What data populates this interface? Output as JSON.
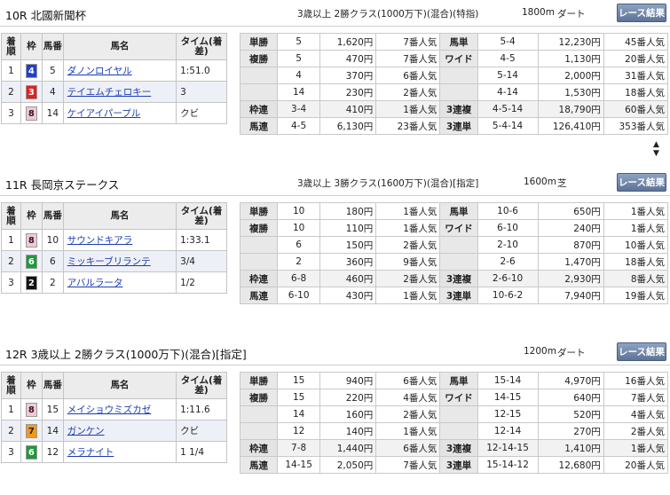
{
  "races": [
    {
      "name": "10R 北國新聞杯",
      "conditions": "3歳以上 2勝クラス(1000万下)(混合)(特指)",
      "distance": "1800m",
      "surface": "ダート",
      "button": "レース結果",
      "headers": {
        "rank": "着順",
        "frame": "枠",
        "number": "馬番",
        "horse": "馬名",
        "time": "タイム(着差)"
      },
      "results": [
        {
          "rank": "1",
          "frame": "4",
          "frame_bg": "#1f3fd1",
          "frame_fg": "#ffffff",
          "number": "5",
          "horse": "ダノンロイヤル",
          "time": "1:51.0"
        },
        {
          "rank": "2",
          "frame": "3",
          "frame_bg": "#e0211f",
          "frame_fg": "#ffffff",
          "number": "4",
          "horse": "テイエムチェロキー",
          "time": "3"
        },
        {
          "rank": "3",
          "frame": "8",
          "frame_bg": "#f7c6d4",
          "frame_fg": "#222222",
          "number": "14",
          "horse": "ケイアイパープル",
          "time": "クビ"
        }
      ],
      "payouts": [
        {
          "l1": "単勝",
          "c1": "5",
          "y1": "1,620円",
          "p1": "7番人気",
          "l2": "馬単",
          "c2": "5-4",
          "y2": "12,230円",
          "p2": "45番人気"
        },
        {
          "l1": "複勝",
          "c1": "5",
          "y1": "470円",
          "p1": "7番人気",
          "l2": "ワイド",
          "c2": "4-5",
          "y2": "1,130円",
          "p2": "20番人気"
        },
        {
          "l1": "",
          "c1": "4",
          "y1": "370円",
          "p1": "6番人気",
          "l2": "",
          "c2": "5-14",
          "y2": "2,000円",
          "p2": "31番人気"
        },
        {
          "l1": "",
          "c1": "14",
          "y1": "230円",
          "p1": "2番人気",
          "l2": "",
          "c2": "4-14",
          "y2": "1,530円",
          "p2": "18番人気"
        },
        {
          "l1": "枠連",
          "c1": "3-4",
          "y1": "410円",
          "p1": "1番人気",
          "l2": "3連複",
          "c2": "4-5-14",
          "y2": "18,790円",
          "p2": "60番人気"
        },
        {
          "l1": "馬連",
          "c1": "4-5",
          "y1": "6,130円",
          "p1": "23番人気",
          "l2": "3連単",
          "c2": "5-4-14",
          "y2": "126,410円",
          "p2": "353番人気"
        }
      ]
    },
    {
      "name": "11R 長岡京ステークス",
      "conditions": "3歳以上 3勝クラス(1600万下)(混合)[指定]",
      "distance": "1600m",
      "surface": "芝",
      "button": "レース結果",
      "headers": {
        "rank": "着順",
        "frame": "枠",
        "number": "馬番",
        "horse": "馬名",
        "time": "タイム(着差)"
      },
      "results": [
        {
          "rank": "1",
          "frame": "8",
          "frame_bg": "#f7c6d4",
          "frame_fg": "#222222",
          "number": "10",
          "horse": "サウンドキアラ",
          "time": "1:33.1"
        },
        {
          "rank": "2",
          "frame": "6",
          "frame_bg": "#1e9a3a",
          "frame_fg": "#ffffff",
          "number": "6",
          "horse": "ミッキーブリランテ",
          "time": "3/4"
        },
        {
          "rank": "3",
          "frame": "2",
          "frame_bg": "#111111",
          "frame_fg": "#ffffff",
          "number": "2",
          "horse": "アバルラータ",
          "time": "1/2"
        }
      ],
      "payouts": [
        {
          "l1": "単勝",
          "c1": "10",
          "y1": "180円",
          "p1": "1番人気",
          "l2": "馬単",
          "c2": "10-6",
          "y2": "650円",
          "p2": "1番人気"
        },
        {
          "l1": "複勝",
          "c1": "10",
          "y1": "110円",
          "p1": "1番人気",
          "l2": "ワイド",
          "c2": "6-10",
          "y2": "240円",
          "p2": "1番人気"
        },
        {
          "l1": "",
          "c1": "6",
          "y1": "150円",
          "p1": "2番人気",
          "l2": "",
          "c2": "2-10",
          "y2": "870円",
          "p2": "10番人気"
        },
        {
          "l1": "",
          "c1": "2",
          "y1": "360円",
          "p1": "9番人気",
          "l2": "",
          "c2": "2-6",
          "y2": "1,470円",
          "p2": "18番人気"
        },
        {
          "l1": "枠連",
          "c1": "6-8",
          "y1": "460円",
          "p1": "2番人気",
          "l2": "3連複",
          "c2": "2-6-10",
          "y2": "2,930円",
          "p2": "8番人気"
        },
        {
          "l1": "馬連",
          "c1": "6-10",
          "y1": "430円",
          "p1": "1番人気",
          "l2": "3連単",
          "c2": "10-6-2",
          "y2": "7,940円",
          "p2": "19番人気"
        }
      ]
    },
    {
      "name": "12R 3歳以上 2勝クラス(1000万下)(混合)[指定]",
      "conditions": "",
      "distance": "1200m",
      "surface": "ダート",
      "button": "レース結果",
      "headers": {
        "rank": "着順",
        "frame": "枠",
        "number": "馬番",
        "horse": "馬名",
        "time": "タイム(着差)"
      },
      "results": [
        {
          "rank": "1",
          "frame": "8",
          "frame_bg": "#f7c6d4",
          "frame_fg": "#222222",
          "number": "15",
          "horse": "メイショウミズカゼ",
          "time": "1:11.6"
        },
        {
          "rank": "2",
          "frame": "7",
          "frame_bg": "#f39a1d",
          "frame_fg": "#222222",
          "number": "14",
          "horse": "ガンケン",
          "time": "クビ"
        },
        {
          "rank": "3",
          "frame": "6",
          "frame_bg": "#1e9a3a",
          "frame_fg": "#ffffff",
          "number": "12",
          "horse": "メラナイト",
          "time": "1 1/4"
        }
      ],
      "payouts": [
        {
          "l1": "単勝",
          "c1": "15",
          "y1": "940円",
          "p1": "6番人気",
          "l2": "馬単",
          "c2": "15-14",
          "y2": "4,970円",
          "p2": "16番人気"
        },
        {
          "l1": "複勝",
          "c1": "15",
          "y1": "220円",
          "p1": "4番人気",
          "l2": "ワイド",
          "c2": "14-15",
          "y2": "640円",
          "p2": "7番人気"
        },
        {
          "l1": "",
          "c1": "14",
          "y1": "160円",
          "p1": "2番人気",
          "l2": "",
          "c2": "12-15",
          "y2": "520円",
          "p2": "4番人気"
        },
        {
          "l1": "",
          "c1": "12",
          "y1": "140円",
          "p1": "1番人気",
          "l2": "",
          "c2": "12-14",
          "y2": "270円",
          "p2": "2番人気"
        },
        {
          "l1": "枠連",
          "c1": "7-8",
          "y1": "1,440円",
          "p1": "6番人気",
          "l2": "3連複",
          "c2": "12-14-15",
          "y2": "1,410円",
          "p2": "1番人気"
        },
        {
          "l1": "馬連",
          "c1": "14-15",
          "y1": "2,050円",
          "p2": "20番人気",
          "p1": "7番人気",
          "l2": "3連単",
          "c2": "15-14-12",
          "y2": "12,680円"
        }
      ]
    }
  ]
}
